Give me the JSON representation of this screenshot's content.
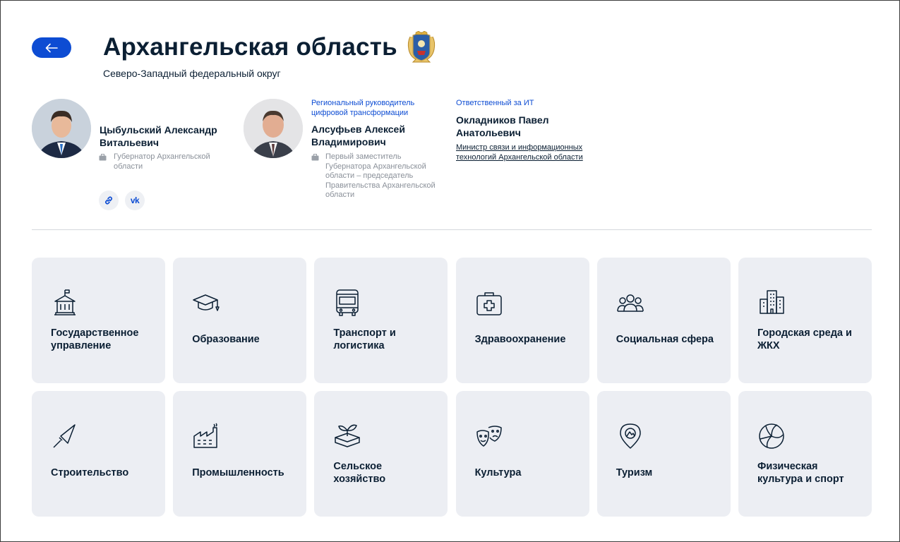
{
  "header": {
    "title": "Архангельская область",
    "district": "Северо-Западный федеральный округ",
    "back_icon": "arrow-left-icon",
    "brand_color": "#0d4cd3"
  },
  "people": [
    {
      "role": "",
      "name_line1": "Цыбульский Александр",
      "name_line2": "Витальевич",
      "position_lines": [
        "Губернатор Архангельской",
        "области"
      ]
    },
    {
      "role_line1": "Региональный руководитель",
      "role_line2": "цифровой трансформации",
      "name_line1": "Алсуфьев Алексей",
      "name_line2": "Владимирович",
      "position_lines": [
        "Первый заместитель",
        "Губернатора Архангельской",
        "области – председатель",
        "Правительства Архангельской",
        "области"
      ]
    },
    {
      "role": "Ответственный за ИТ",
      "name_line1": "Окладников Павел",
      "name_line2": "Анатольевич",
      "link_line1": "Министр связи и информационных",
      "link_line2": "технологий Архангельской области"
    }
  ],
  "social": {
    "link_icon": "link-icon",
    "vk_label": "vk"
  },
  "categories": [
    {
      "l1": "Государственное",
      "l2": "управление",
      "icon": "government-building-icon"
    },
    {
      "l1": "Образование",
      "l2": "",
      "icon": "graduation-cap-icon"
    },
    {
      "l1": "Транспорт и",
      "l2": "логистика",
      "icon": "bus-icon"
    },
    {
      "l1": "Здравоохранение",
      "l2": "",
      "icon": "medical-kit-icon"
    },
    {
      "l1": "Социальная сфера",
      "l2": "",
      "icon": "people-group-icon"
    },
    {
      "l1": "Городская среда и",
      "l2": "ЖКХ",
      "icon": "city-buildings-icon"
    },
    {
      "l1": "Строительство",
      "l2": "",
      "icon": "trowel-icon"
    },
    {
      "l1": "Промышленность",
      "l2": "",
      "icon": "factory-icon"
    },
    {
      "l1": "Сельское",
      "l2": "хозяйство",
      "icon": "sprout-icon"
    },
    {
      "l1": "Культура",
      "l2": "",
      "icon": "theater-masks-icon"
    },
    {
      "l1": "Туризм",
      "l2": "",
      "icon": "map-pin-icon"
    },
    {
      "l1": "Физическая",
      "l2": "культура и спорт",
      "icon": "volleyball-icon"
    }
  ]
}
